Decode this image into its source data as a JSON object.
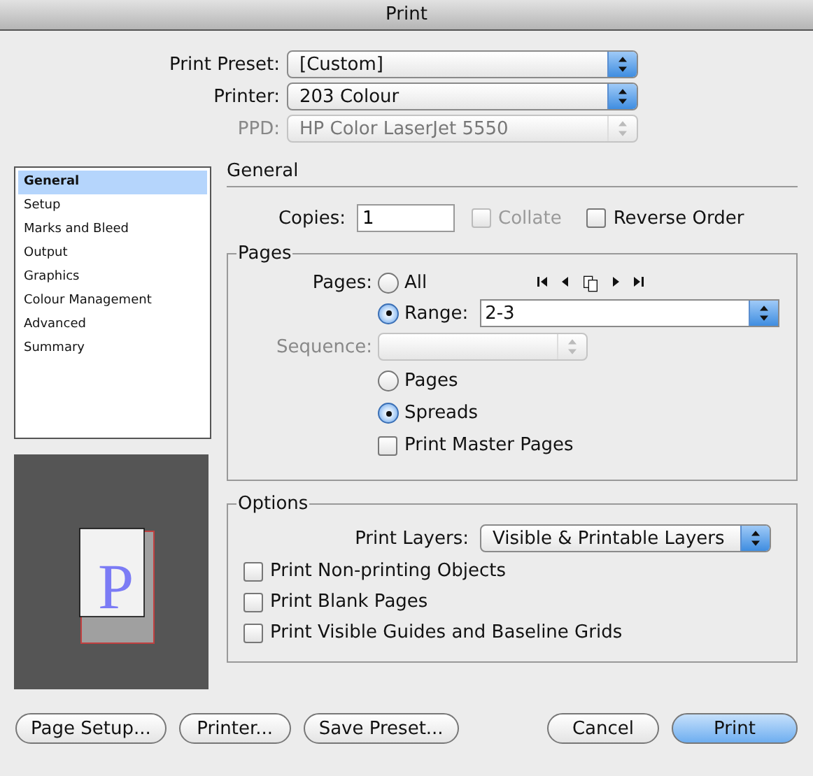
{
  "window": {
    "title": "Print"
  },
  "presets": [
    {
      "label": "Print Preset:",
      "value": "[Custom]",
      "disabled": false
    },
    {
      "label": "Printer:",
      "value": "203 Colour",
      "disabled": false
    },
    {
      "label": "PPD:",
      "value": "HP Color LaserJet 5550",
      "disabled": true
    }
  ],
  "sidebar": {
    "items": [
      {
        "label": "General",
        "selected": true
      },
      {
        "label": "Setup",
        "selected": false
      },
      {
        "label": "Marks and Bleed",
        "selected": false
      },
      {
        "label": "Output",
        "selected": false
      },
      {
        "label": "Graphics",
        "selected": false
      },
      {
        "label": "Colour Management",
        "selected": false
      },
      {
        "label": "Advanced",
        "selected": false
      },
      {
        "label": "Summary",
        "selected": false
      }
    ]
  },
  "preview": {
    "letter": "P"
  },
  "panel": {
    "title": "General",
    "copies": {
      "label": "Copies:",
      "value": "1"
    },
    "collate": {
      "label": "Collate",
      "checked": false,
      "disabled": true
    },
    "reverse_order": {
      "label": "Reverse Order",
      "checked": false
    },
    "pages": {
      "title": "Pages",
      "label": "Pages:",
      "range_options": [
        {
          "label": "All",
          "selected": false
        },
        {
          "label": "Range:",
          "selected": true
        }
      ],
      "range_value": "2-3",
      "sequence": {
        "label": "Sequence:",
        "disabled": true
      },
      "layout_options": [
        {
          "label": "Pages",
          "selected": false
        },
        {
          "label": "Spreads",
          "selected": true
        }
      ],
      "print_master_pages": {
        "label": "Print Master Pages",
        "checked": false
      }
    },
    "options": {
      "title": "Options",
      "print_layers": {
        "label": "Print Layers:",
        "value": "Visible & Printable Layers"
      },
      "checkboxes": [
        {
          "label": "Print Non-printing Objects",
          "checked": false
        },
        {
          "label": "Print Blank Pages",
          "checked": false
        },
        {
          "label": "Print Visible Guides and Baseline Grids",
          "checked": false
        }
      ]
    }
  },
  "buttons_left": [
    {
      "label": "Page Setup...",
      "default": false
    },
    {
      "label": "Printer...",
      "default": false
    },
    {
      "label": "Save Preset...",
      "default": false
    }
  ],
  "buttons_right": [
    {
      "label": "Cancel",
      "default": false
    },
    {
      "label": "Print",
      "default": true
    }
  ]
}
